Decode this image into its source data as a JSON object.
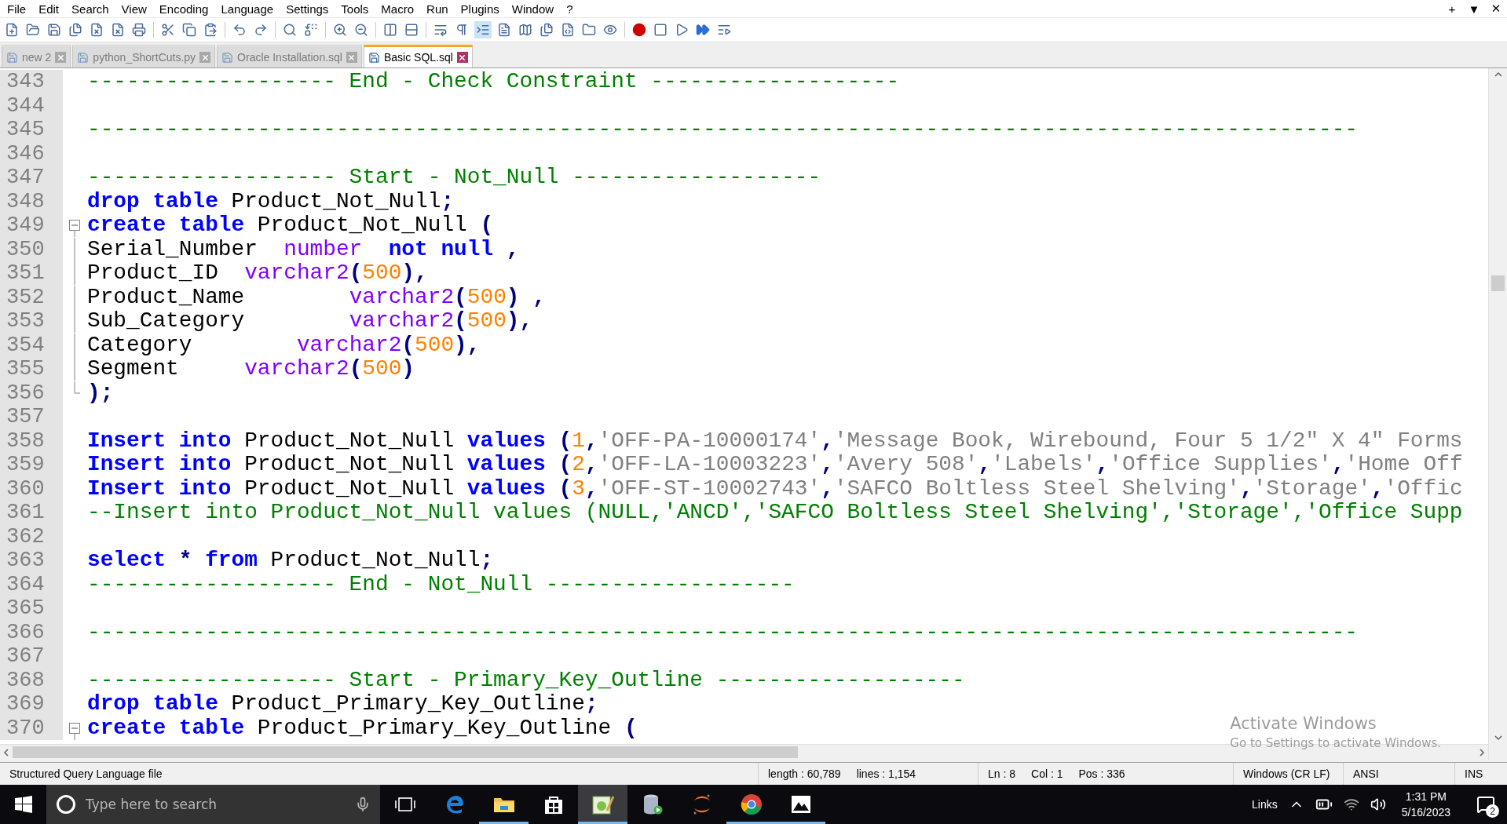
{
  "menu": [
    "File",
    "Edit",
    "Search",
    "View",
    "Encoding",
    "Language",
    "Settings",
    "Tools",
    "Macro",
    "Run",
    "Plugins",
    "Window",
    "?"
  ],
  "window_controls": [
    "+",
    "▼",
    "✕"
  ],
  "tabs": [
    {
      "label": "new 2",
      "selected": false
    },
    {
      "label": "python_ShortCuts.py",
      "selected": false
    },
    {
      "label": "Oracle Installation.sql",
      "selected": false
    },
    {
      "label": "Basic SQL.sql",
      "selected": true
    }
  ],
  "editor": {
    "lines": [
      {
        "n": "343",
        "tokens": [
          {
            "kind": "comment",
            "text": "------------------- End - Check Constraint -------------------"
          }
        ]
      },
      {
        "n": "344"
      },
      {
        "n": "345",
        "tokens": [
          {
            "kind": "comment",
            "text": "-------------------------------------------------------------------------------------------------"
          }
        ]
      },
      {
        "n": "346"
      },
      {
        "n": "347",
        "tokens": [
          {
            "kind": "comment",
            "text": "------------------- Start - Not_Null -------------------"
          }
        ]
      },
      {
        "n": "348",
        "tokens": [
          {
            "kind": "keyword",
            "text": "drop table"
          },
          {
            "kind": "ident",
            "text": " Product_Not_Null"
          },
          {
            "kind": "op",
            "text": ";"
          }
        ]
      },
      {
        "n": "349",
        "fold": {
          "kind": "start"
        },
        "tokens": [
          {
            "kind": "keyword",
            "text": "create table"
          },
          {
            "kind": "ident",
            "text": " Product_Not_Null "
          },
          {
            "kind": "op",
            "text": "("
          }
        ]
      },
      {
        "n": "350",
        "fold": {
          "kind": "body"
        },
        "tokens": [
          {
            "kind": "ident",
            "text": "Serial_Number  "
          },
          {
            "kind": "type",
            "text": "number"
          },
          {
            "kind": "keyword",
            "text": "  not null"
          },
          {
            "kind": "op",
            "text": " ,"
          }
        ]
      },
      {
        "n": "351",
        "fold": {
          "kind": "body"
        },
        "tokens": [
          {
            "kind": "ident",
            "text": "Product_ID  "
          },
          {
            "kind": "type",
            "text": "varchar2"
          },
          {
            "kind": "op",
            "text": "("
          },
          {
            "kind": "number",
            "text": "500"
          },
          {
            "kind": "op",
            "text": "),"
          }
        ]
      },
      {
        "n": "352",
        "fold": {
          "kind": "body"
        },
        "tokens": [
          {
            "kind": "ident",
            "text": "Product_Name        "
          },
          {
            "kind": "type",
            "text": "varchar2"
          },
          {
            "kind": "op",
            "text": "("
          },
          {
            "kind": "number",
            "text": "500"
          },
          {
            "kind": "op",
            "text": ") ,"
          }
        ]
      },
      {
        "n": "353",
        "fold": {
          "kind": "body"
        },
        "tokens": [
          {
            "kind": "ident",
            "text": "Sub_Category        "
          },
          {
            "kind": "type",
            "text": "varchar2"
          },
          {
            "kind": "op",
            "text": "("
          },
          {
            "kind": "number",
            "text": "500"
          },
          {
            "kind": "op",
            "text": "),"
          }
        ]
      },
      {
        "n": "354",
        "fold": {
          "kind": "body"
        },
        "tokens": [
          {
            "kind": "ident",
            "text": "Category        "
          },
          {
            "kind": "type",
            "text": "varchar2"
          },
          {
            "kind": "op",
            "text": "("
          },
          {
            "kind": "number",
            "text": "500"
          },
          {
            "kind": "op",
            "text": "),"
          }
        ]
      },
      {
        "n": "355",
        "fold": {
          "kind": "body"
        },
        "tokens": [
          {
            "kind": "ident",
            "text": "Segment     "
          },
          {
            "kind": "type",
            "text": "varchar2"
          },
          {
            "kind": "op",
            "text": "("
          },
          {
            "kind": "number",
            "text": "500"
          },
          {
            "kind": "op",
            "text": ")"
          }
        ]
      },
      {
        "n": "356",
        "fold": {
          "kind": "end"
        },
        "tokens": [
          {
            "kind": "op",
            "text": ");"
          }
        ]
      },
      {
        "n": "357"
      },
      {
        "n": "358",
        "tokens": [
          {
            "kind": "keyword",
            "text": "Insert into"
          },
          {
            "kind": "ident",
            "text": " Product_Not_Null "
          },
          {
            "kind": "keyword",
            "text": "values"
          },
          {
            "kind": "op",
            "text": " ("
          },
          {
            "kind": "number",
            "text": "1"
          },
          {
            "kind": "op",
            "text": ","
          },
          {
            "kind": "string",
            "text": "'OFF-PA-10000174'"
          },
          {
            "kind": "op",
            "text": ","
          },
          {
            "kind": "string",
            "text": "'Message Book, Wirebound, Four 5 1/2\" X 4\" Forms"
          }
        ]
      },
      {
        "n": "359",
        "tokens": [
          {
            "kind": "keyword",
            "text": "Insert into"
          },
          {
            "kind": "ident",
            "text": " Product_Not_Null "
          },
          {
            "kind": "keyword",
            "text": "values"
          },
          {
            "kind": "op",
            "text": " ("
          },
          {
            "kind": "number",
            "text": "2"
          },
          {
            "kind": "op",
            "text": ","
          },
          {
            "kind": "string",
            "text": "'OFF-LA-10003223'"
          },
          {
            "kind": "op",
            "text": ","
          },
          {
            "kind": "string",
            "text": "'Avery 508'"
          },
          {
            "kind": "op",
            "text": ","
          },
          {
            "kind": "string",
            "text": "'Labels'"
          },
          {
            "kind": "op",
            "text": ","
          },
          {
            "kind": "string",
            "text": "'Office Supplies'"
          },
          {
            "kind": "op",
            "text": ","
          },
          {
            "kind": "string",
            "text": "'Home Off"
          }
        ]
      },
      {
        "n": "360",
        "tokens": [
          {
            "kind": "keyword",
            "text": "Insert into"
          },
          {
            "kind": "ident",
            "text": " Product_Not_Null "
          },
          {
            "kind": "keyword",
            "text": "values"
          },
          {
            "kind": "op",
            "text": " ("
          },
          {
            "kind": "number",
            "text": "3"
          },
          {
            "kind": "op",
            "text": ","
          },
          {
            "kind": "string",
            "text": "'OFF-ST-10002743'"
          },
          {
            "kind": "op",
            "text": ","
          },
          {
            "kind": "string",
            "text": "'SAFCO Boltless Steel Shelving'"
          },
          {
            "kind": "op",
            "text": ","
          },
          {
            "kind": "string",
            "text": "'Storage'"
          },
          {
            "kind": "op",
            "text": ","
          },
          {
            "kind": "string",
            "text": "'Offic"
          }
        ]
      },
      {
        "n": "361",
        "tokens": [
          {
            "kind": "comment",
            "text": "--Insert into Product_Not_Null values (NULL,'ANCD','SAFCO Boltless Steel Shelving','Storage','Office Supp"
          }
        ]
      },
      {
        "n": "362"
      },
      {
        "n": "363",
        "tokens": [
          {
            "kind": "keyword",
            "text": "select"
          },
          {
            "kind": "op",
            "text": " * "
          },
          {
            "kind": "keyword",
            "text": "from"
          },
          {
            "kind": "ident",
            "text": " Product_Not_Null"
          },
          {
            "kind": "op",
            "text": ";"
          }
        ]
      },
      {
        "n": "364",
        "tokens": [
          {
            "kind": "comment",
            "text": "------------------- End - Not_Null -------------------"
          }
        ]
      },
      {
        "n": "365"
      },
      {
        "n": "366",
        "tokens": [
          {
            "kind": "comment",
            "text": "-------------------------------------------------------------------------------------------------"
          }
        ]
      },
      {
        "n": "367"
      },
      {
        "n": "368",
        "tokens": [
          {
            "kind": "comment",
            "text": "------------------- Start - Primary_Key_Outline -------------------"
          }
        ]
      },
      {
        "n": "369",
        "tokens": [
          {
            "kind": "keyword",
            "text": "drop table"
          },
          {
            "kind": "ident",
            "text": " Product_Primary_Key_Outline"
          },
          {
            "kind": "op",
            "text": ";"
          }
        ]
      },
      {
        "n": "370",
        "fold": {
          "kind": "start"
        },
        "tokens": [
          {
            "kind": "keyword",
            "text": "create table"
          },
          {
            "kind": "ident",
            "text": " Product_Primary_Key_Outline "
          },
          {
            "kind": "op",
            "text": "("
          }
        ]
      }
    ]
  },
  "os_overlay": {
    "title": "Activate Windows",
    "subtitle": "Go to Settings to activate Windows."
  },
  "status_bar": {
    "file_type": "Structured Query Language file",
    "length": "length : 60,789",
    "lines": "lines : 1,154",
    "ln": "Ln : 8",
    "col": "Col : 1",
    "pos": "Pos : 336",
    "eol": "Windows (CR LF)",
    "encoding": "ANSI",
    "mode": "INS"
  },
  "taskbar": {
    "search": {
      "placeholder": "Type here to search"
    },
    "apps": [
      {
        "kind": "task_view",
        "running": false,
        "selected": false
      },
      {
        "kind": "edge",
        "running": false,
        "selected": false
      },
      {
        "kind": "explorer",
        "running": true,
        "selected": false
      },
      {
        "kind": "store",
        "running": false,
        "selected": false
      },
      {
        "kind": "notepad",
        "running": true,
        "selected": true
      },
      {
        "kind": "database",
        "running": false,
        "selected": false
      },
      {
        "kind": "jupyter",
        "running": false,
        "selected": false
      },
      {
        "kind": "chrome",
        "running": true,
        "selected": false
      },
      {
        "kind": "photos",
        "running": true,
        "selected": false
      }
    ],
    "links": "Links",
    "time": "1:31 PM",
    "date": "5/16/2023",
    "notifications": "2"
  }
}
